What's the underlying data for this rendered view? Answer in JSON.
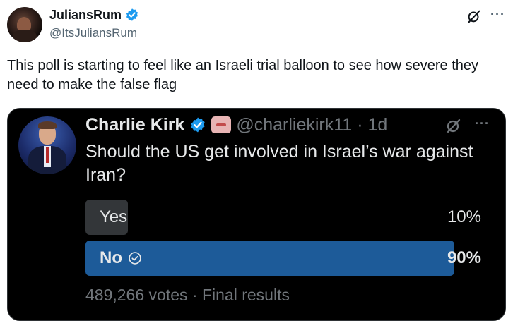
{
  "author": {
    "name": "JuliansRum",
    "handle": "@ItsJuliansRum"
  },
  "tweet": {
    "text": "This poll is starting to feel like an Israeli trial balloon to see how severe they need to make the false flag"
  },
  "quoted": {
    "name": "Charlie Kirk",
    "handle": "@charliekirk11",
    "separator": "·",
    "time": "1d",
    "text": "Should the US get involved in Israel’s war against Iran?",
    "poll": {
      "options": [
        {
          "label": "Yes",
          "percent": "10%",
          "fill_fraction": 0.1
        },
        {
          "label": "No",
          "percent": "90%",
          "fill_fraction": 0.9,
          "selected": true
        }
      ],
      "votes": "489,266 votes",
      "separator": "·",
      "status": "Final results"
    }
  },
  "icons": {
    "verified": "verified-badge-icon",
    "grok": "grok-icon",
    "more": "more-icon",
    "check": "check-circle-icon"
  },
  "colors": {
    "verified_blue": "#1d9bf0",
    "poll_winner": "#1d5b99",
    "poll_loser": "#333639"
  }
}
